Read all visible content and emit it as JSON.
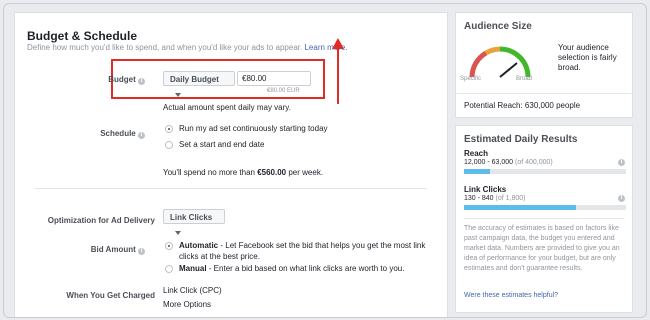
{
  "budget_section": {
    "title": "Budget & Schedule",
    "description": "Define how much you'd like to spend, and when you'd like your ads to appear.",
    "learn_more": "Learn more.",
    "budget_label": "Budget",
    "budget_type": "Daily Budget",
    "budget_amount": "€80.00",
    "budget_converted": "€80.00 EUR",
    "actual_note": "Actual amount spent daily may vary.",
    "schedule_label": "Schedule",
    "schedule_options": [
      {
        "label": "Run my ad set continuously starting today",
        "checked": true
      },
      {
        "label": "Set a start and end date",
        "checked": false
      }
    ],
    "spend_prefix": "You'll spend no more than",
    "spend_amount": "€560.00",
    "spend_suffix": "per week.",
    "highlight_color": "#e02b27"
  },
  "delivery_section": {
    "optimization_label": "Optimization for Ad Delivery",
    "optimization_value": "Link Clicks",
    "bid_label": "Bid Amount",
    "bid_options": [
      {
        "title": "Automatic",
        "text": "- Let Facebook set the bid that helps you get the most link clicks at the best price.",
        "checked": true
      },
      {
        "title": "Manual",
        "text": "- Enter a bid based on what link clicks are worth to you.",
        "checked": false
      }
    ],
    "charged_label": "When You Get Charged",
    "charged_value": "Link Click (CPC)",
    "more_options": "More Options"
  },
  "audience_size": {
    "title": "Audience Size",
    "description": "Your audience selection is fairly broad.",
    "specific_label": "Specific",
    "broad_label": "Broad",
    "potential_reach": "Potential Reach: 630,000 people",
    "gauge_level": 0.78
  },
  "daily_results": {
    "title": "Estimated Daily Results",
    "reach_label": "Reach",
    "reach_range": "12,000 - 63,000",
    "reach_total": "(of 400,000)",
    "reach_fill": 0.16,
    "clicks_label": "Link Clicks",
    "clicks_range": "130 - 840",
    "clicks_total": "(of 1,800)",
    "clicks_fill": 0.69,
    "disclaimer": "The accuracy of estimates is based on factors like past campaign data, the budget you entered and market data. Numbers are provided to give you an idea of performance for your budget, but are only estimates and don't guarantee results.",
    "helpful_link": "Were these estimates helpful?"
  },
  "colors": {
    "link": "#4267b2",
    "bar_fill": "#5ebced",
    "gauge_red": "#d9534f",
    "gauge_green": "#42b72a"
  }
}
